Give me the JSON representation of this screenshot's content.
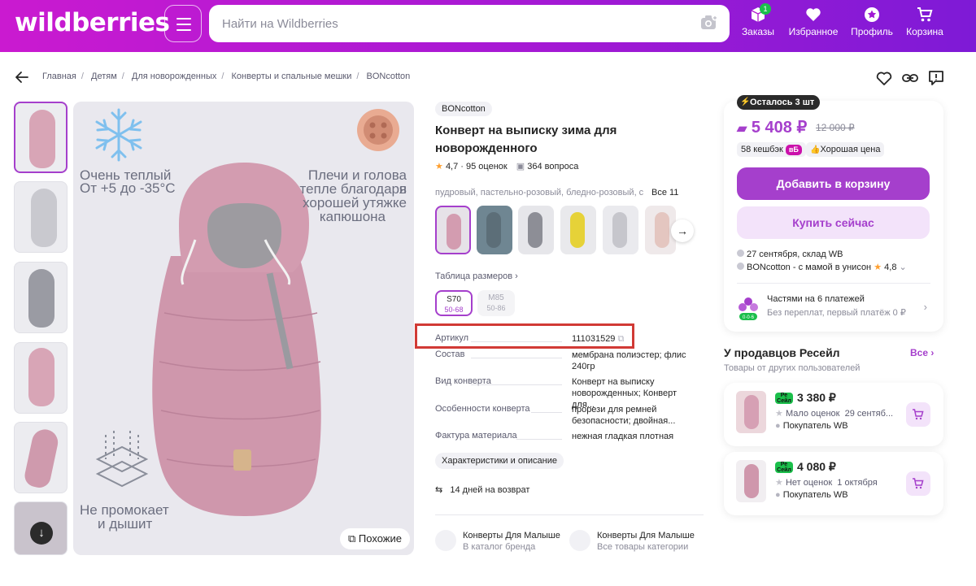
{
  "header": {
    "logo": "wildberries",
    "search_placeholder": "Найти на Wildberries",
    "nav": [
      {
        "label": "Заказы",
        "badge": "1"
      },
      {
        "label": "Избранное"
      },
      {
        "label": "Профиль"
      },
      {
        "label": "Корзина"
      }
    ],
    "accent": "#a53fcc"
  },
  "breadcrumbs": [
    "Главная",
    "Детям",
    "Для новорожденных",
    "Конверты и спальные мешки",
    "BONcotton"
  ],
  "gallery": {
    "image_text_1": "Очень теплый",
    "image_text_2": "От +5 до -35°C",
    "image_text_3": "Плечи и голова в",
    "image_text_4": "тепле благодаря",
    "image_text_5": "хорошей утяжке",
    "image_text_6": "капюшона",
    "image_text_7": "Не промокает",
    "image_text_8": "и дышит",
    "similar_label": "Похожие"
  },
  "product": {
    "brand": "BONcotton",
    "title": "Конверт на выписку зима для новорожденного",
    "rating": "4,7",
    "reviews": "95 оценок",
    "questions": "364 вопроса",
    "colors": "пудровый, пастельно-розовый, бледно-розовый, с",
    "colors_all": "Все 11",
    "size_table": "Таблица размеров",
    "sizes": [
      {
        "name": "S70",
        "range": "50-68",
        "selected": true
      },
      {
        "name": "M85",
        "range": "50-86",
        "selected": false
      }
    ],
    "specs": [
      {
        "key": "Артикул",
        "value": "111031529"
      },
      {
        "key": "Состав",
        "value": "мембрана полиэстер; флис 240гр"
      },
      {
        "key": "Вид конверта",
        "value": "Конверт на выписку новорожденных; Конверт для..."
      },
      {
        "key": "Особенности конверта",
        "value": "прорези для ремней безопасности; двойная..."
      },
      {
        "key": "Фактура материала",
        "value": "нежная гладкая плотная"
      }
    ],
    "description_button": "Характеристики и описание",
    "return_text": "14 дней на возврат",
    "brand_links": [
      {
        "title": "Конверты Для Малышей",
        "subtitle": "В каталог бренда"
      },
      {
        "title": "Конверты Для Малышей",
        "subtitle": "Все товары категории"
      }
    ]
  },
  "buy": {
    "stock_badge": "Осталось 3 шт",
    "price": "5 408 ₽",
    "old_price": "12 000 ₽",
    "cashback": "58 кешбэк",
    "cashback_tag": "вБ",
    "good_price": "Хорошая цена",
    "add_to_cart": "Добавить в корзину",
    "buy_now": "Купить сейчас",
    "delivery": "27 сентября, склад WB",
    "seller": "BONcotton - с мамой в унисон",
    "seller_rating": "4,8",
    "installments_title": "Частями на 6 платежей",
    "installments_sub": "Без переплат, первый платёж 0 ₽"
  },
  "resale": {
    "title": "У продавцов Ресейл",
    "all": "Все",
    "subtitle": "Товары от других пользователей",
    "offers": [
      {
        "tag": "Ре Сейл",
        "price": "3 380 ₽",
        "rating": "Мало оценок",
        "date": "29 сентяб...",
        "seller": "Покупатель WB"
      },
      {
        "tag": "Ре Сейл",
        "price": "4 080 ₽",
        "rating": "Нет оценок",
        "date": "1 октября",
        "seller": "Покупатель WB"
      }
    ]
  }
}
